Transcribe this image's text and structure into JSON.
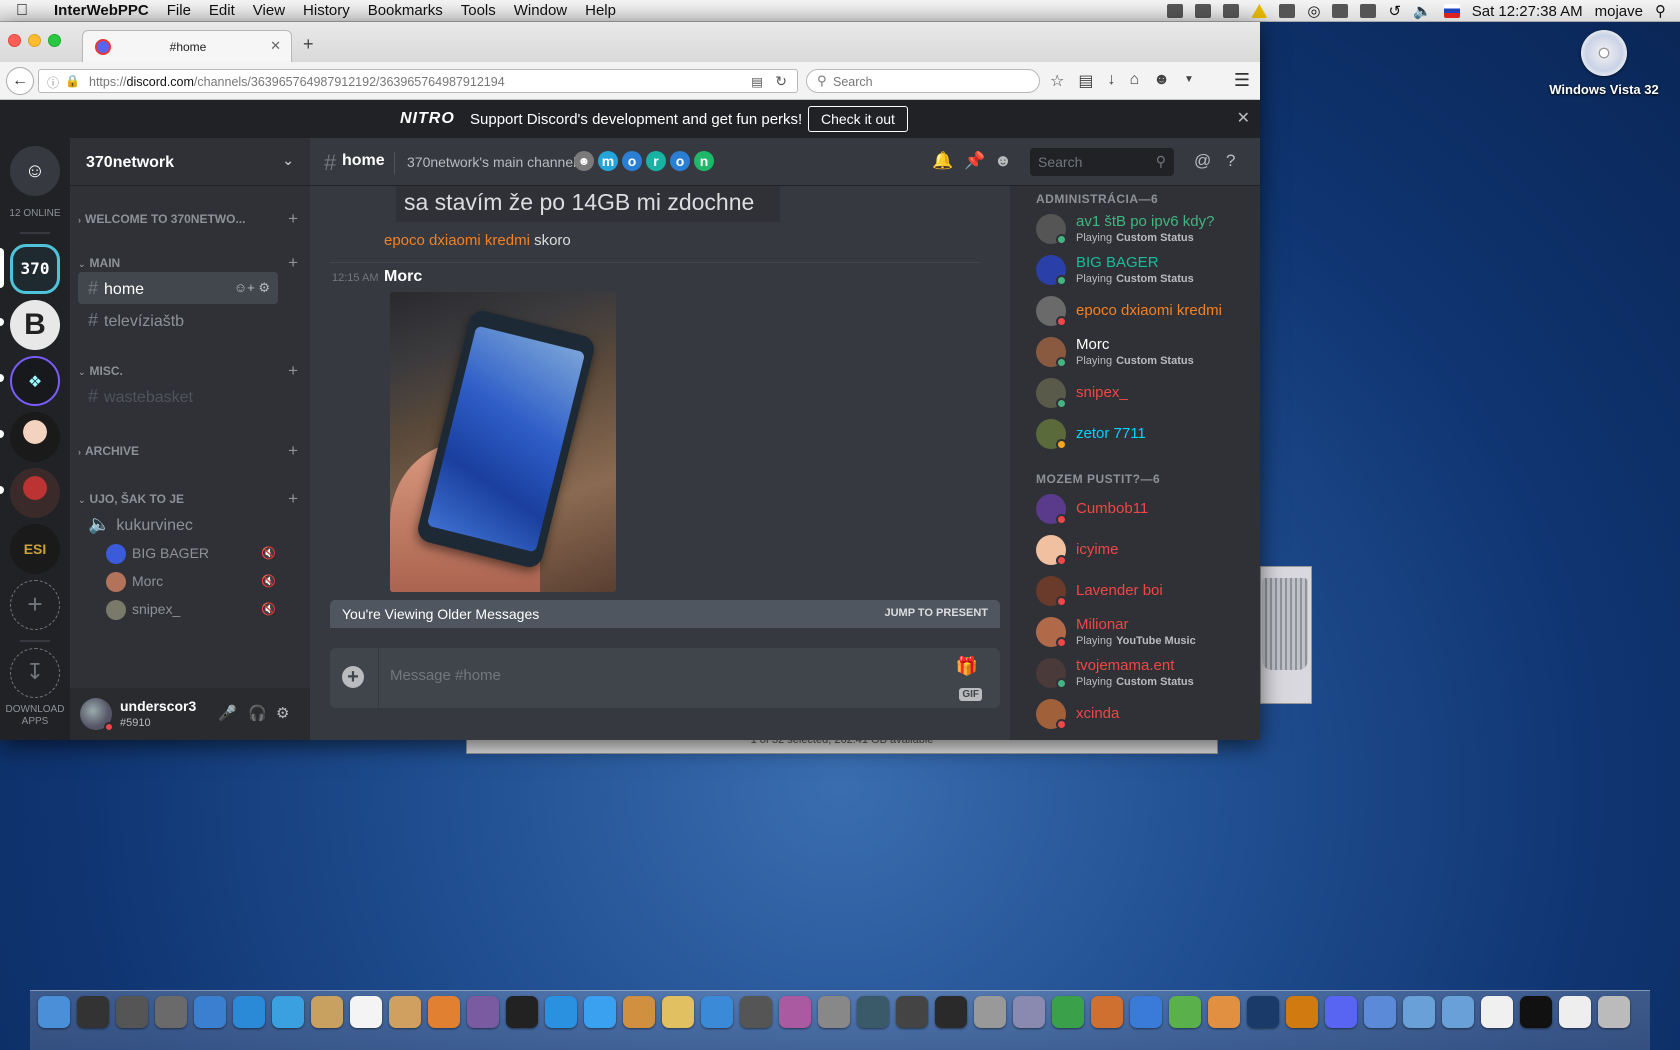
{
  "menubar": {
    "app_name": "InterWebPPC",
    "items": [
      "File",
      "Edit",
      "View",
      "History",
      "Bookmarks",
      "Tools",
      "Window",
      "Help"
    ],
    "clock": "Sat 12:27:38 AM",
    "user": "mojave"
  },
  "desktop": {
    "dvd_label": "Windows Vista 32",
    "finder_status": "1 of 32 selected, 262.41 GB available"
  },
  "browser": {
    "tab_title": "#home",
    "url_prefix": "https://",
    "url_host": "discord.com",
    "url_path": "/channels/363965764987912192/363965764987912194",
    "search_placeholder": "Search"
  },
  "discord": {
    "nitro": {
      "logo": "NITRO",
      "text": "Support Discord's development and get fun perks!",
      "button": "Check it out"
    },
    "guilds": {
      "online": "12 ONLINE",
      "server_370": "370",
      "server_b": "B",
      "download_label_1": "DOWNLOAD",
      "download_label_2": "APPS"
    },
    "server": {
      "name": "370network",
      "categories": {
        "welcome": "WELCOME TO 370NETWO...",
        "main": "MAIN",
        "misc": "MISC.",
        "archive": "ARCHIVE",
        "ujo": "UJO, ŠAK TO JE"
      },
      "channels": {
        "home": "home",
        "tv": "televíziaštb",
        "wastebasket": "wastebasket",
        "voice": "kukurvinec"
      },
      "voice_users": [
        "BIG BAGER",
        "Morc",
        "snipex_"
      ]
    },
    "user_panel": {
      "username": "underscor3",
      "tag": "#5910"
    },
    "chat": {
      "channel": "home",
      "topic": "370network's main channel",
      "emoji_letters": [
        "m",
        "o",
        "r",
        "o",
        "n"
      ],
      "search_placeholder": "Search",
      "quoted_text": "sa stavím že po 14GB mi zdochne",
      "reply_author": "epoco dxiaomi kredmi",
      "reply_text": "skoro",
      "message_time": "12:15 AM",
      "message_author": "Morc",
      "older_notice": "You're Viewing Older Messages",
      "jump_label": "JUMP TO PRESENT",
      "composer_placeholder": "Message #home",
      "gif_label": "GIF"
    },
    "members": {
      "groups": [
        {
          "title": "ADMINISTRÁCIA—6",
          "members": [
            {
              "name": "av1 štB po ipv6 kdy?",
              "color": "#43b581",
              "status": "online",
              "sub_prefix": "Playing",
              "sub_bold": "Custom Status"
            },
            {
              "name": "BIG BAGER",
              "color": "#1abc9c",
              "status": "online",
              "sub_prefix": "Playing",
              "sub_bold": "Custom Status"
            },
            {
              "name": "epoco dxiaomi kredmi",
              "color": "#f48024",
              "status": "dnd",
              "sub_prefix": "",
              "sub_bold": ""
            },
            {
              "name": "Morc",
              "color": "#ffffff",
              "status": "online",
              "sub_prefix": "Playing",
              "sub_bold": "Custom Status"
            },
            {
              "name": "snipex_",
              "color": "#f04747",
              "status": "online",
              "sub_prefix": "",
              "sub_bold": ""
            },
            {
              "name": "zetor 7711",
              "color": "#00d4ff",
              "status": "idle",
              "sub_prefix": "",
              "sub_bold": ""
            }
          ]
        },
        {
          "title": "MOZEM PUSTIT?—6",
          "members": [
            {
              "name": "Cumbob11",
              "color": "#f04747",
              "status": "dnd",
              "sub_prefix": "",
              "sub_bold": ""
            },
            {
              "name": "icyime",
              "color": "#f04747",
              "status": "dnd",
              "sub_prefix": "",
              "sub_bold": ""
            },
            {
              "name": "Lavender boi",
              "color": "#f04747",
              "status": "dnd",
              "sub_prefix": "",
              "sub_bold": ""
            },
            {
              "name": "Milionar",
              "color": "#f04747",
              "status": "dnd",
              "sub_prefix": "Playing",
              "sub_bold": "YouTube Music"
            },
            {
              "name": "tvojemama.ent",
              "color": "#f04747",
              "status": "online",
              "sub_prefix": "Playing",
              "sub_bold": "Custom Status"
            },
            {
              "name": "xcinda",
              "color": "#f04747",
              "status": "dnd",
              "sub_prefix": "",
              "sub_bold": ""
            }
          ]
        }
      ]
    }
  },
  "colors": {
    "blurple": "#5865f2",
    "online": "#43b581",
    "idle": "#faa61a",
    "dnd": "#f04747"
  }
}
